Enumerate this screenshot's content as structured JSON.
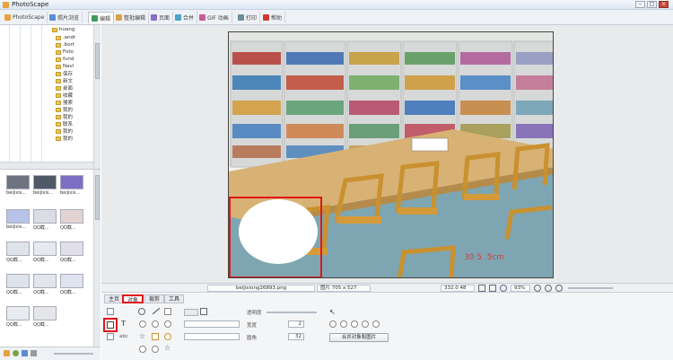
{
  "window": {
    "title": "PhotoScape"
  },
  "tabs": [
    {
      "label": "PhotoScape",
      "color": "#e8a040"
    },
    {
      "label": "照片浏览",
      "color": "#5a8bd6"
    },
    {
      "label": "编辑",
      "color": "#3d9a5b"
    },
    {
      "label": "整批编辑",
      "color": "#d9a24a"
    },
    {
      "label": "页面",
      "color": "#8a6bc9"
    },
    {
      "label": "合并",
      "color": "#4aa3c9"
    },
    {
      "label": "GIF 动画",
      "color": "#c95a9a"
    },
    {
      "label": "打印",
      "color": "#6b8e9a"
    },
    {
      "label": "帮助",
      "color": "#d03a2e"
    }
  ],
  "tree": {
    "items": [
      {
        "label": "huang"
      },
      {
        "label": ".andr"
      },
      {
        "label": ".bort"
      },
      {
        "label": "Foto"
      },
      {
        "label": "fund"
      },
      {
        "label": "Navi"
      },
      {
        "label": "保存"
      },
      {
        "label": "新文"
      },
      {
        "label": "桌面"
      },
      {
        "label": "收藏"
      },
      {
        "label": "搜索"
      },
      {
        "label": "我的"
      },
      {
        "label": "我的"
      },
      {
        "label": "联系"
      },
      {
        "label": "我的"
      },
      {
        "label": "我的"
      }
    ]
  },
  "thumbnails": [
    {
      "caption": "beijixis...",
      "color": "#6d7480"
    },
    {
      "caption": "beijixis...",
      "color": "#4f5a66"
    },
    {
      "caption": "beijixis...",
      "color": "#7c6fc4"
    },
    {
      "caption": "beijixis...",
      "color": "#b8c3e8"
    },
    {
      "caption": "QQ截...",
      "color": "#d9dde4"
    },
    {
      "caption": "QQ截...",
      "color": "#e3d3d3"
    },
    {
      "caption": "QQ截...",
      "color": "#dfe4ea"
    },
    {
      "caption": "QQ截...",
      "color": "#e6e9ee"
    },
    {
      "caption": "QQ截...",
      "color": "#e1dfe9"
    },
    {
      "caption": "QQ截...",
      "color": "#dde3ea"
    },
    {
      "caption": "QQ截...",
      "color": "#e2e5ea"
    },
    {
      "caption": "QQ截...",
      "color": "#dfe3ee"
    },
    {
      "caption": "QQ截...",
      "color": "#e8ebef"
    },
    {
      "caption": "QQ截...",
      "color": "#e4e6ea"
    }
  ],
  "status": {
    "filename": "beijixiong26893.png",
    "size": "图片 705 x 527",
    "position": "332.0 48",
    "zoom": "93%"
  },
  "panel": {
    "tabs": [
      "主页",
      "对象",
      "裁剪",
      "工具"
    ],
    "active_tab": "对象",
    "opacity_label": "透明度",
    "width_label": "宽度",
    "round_label": "圆角",
    "width_value": "2",
    "round_value": "32",
    "merge_button": "合并对象和图片",
    "text_tool_label": "T",
    "abc_label": "abc"
  },
  "photo": {
    "overlay_text": "30 5 .5cm"
  },
  "colors": {
    "highlight": "#e0161b",
    "shelf": "#e6e9ea",
    "table": "#d8b274",
    "chair": "#c9912f",
    "floor": "#7ea6b2"
  }
}
